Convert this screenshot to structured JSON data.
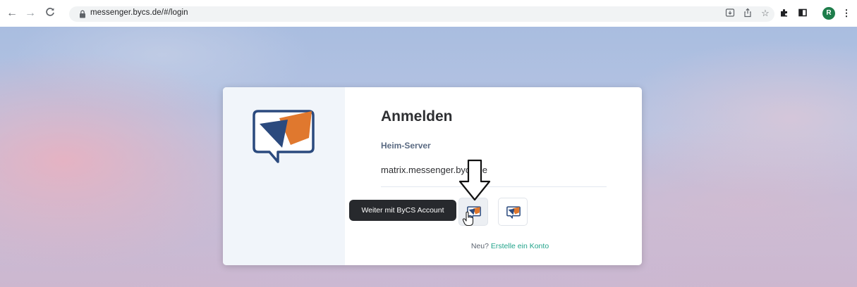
{
  "browser": {
    "back_icon": "arrow-left-icon",
    "forward_icon": "arrow-right-icon",
    "reload_icon": "reload-icon",
    "url": "messenger.bycs.de/#/login",
    "profile_initial": "R"
  },
  "login": {
    "title": "Anmelden",
    "server_label": "Heim-Server",
    "server_value": "matrix.messenger.bycs.de",
    "sso_tooltip": "Weiter mit ByCS Account",
    "signup_prefix": "Neu?",
    "signup_link": "Erstelle ein Konto"
  },
  "colors": {
    "logo_blue": "#2b4a7e",
    "logo_orange": "#e0782e",
    "link_green": "#21a38a",
    "tooltip_bg": "#27292d"
  }
}
